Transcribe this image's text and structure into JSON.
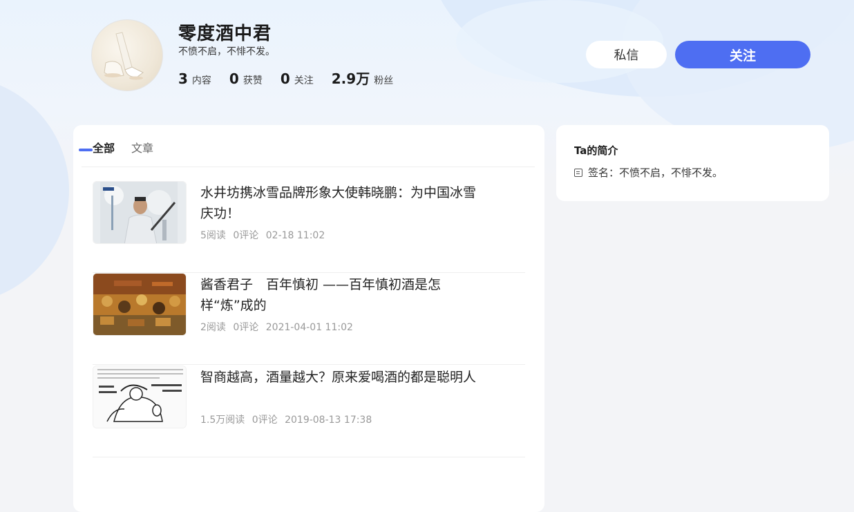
{
  "profile": {
    "name": "零度酒中君",
    "motto": "不愤不启，不悱不发。",
    "stats": [
      {
        "num": "3",
        "label": "内容"
      },
      {
        "num": "0",
        "label": "获赞"
      },
      {
        "num": "0",
        "label": "关注"
      },
      {
        "num": "2.9万",
        "label": "粉丝"
      }
    ],
    "message_label": "私信",
    "follow_label": "关注"
  },
  "tabs": [
    {
      "label": "全部",
      "active": true
    },
    {
      "label": "文章",
      "active": false
    }
  ],
  "articles": [
    {
      "title": "水井坊携冰雪品牌形象大使韩晓鹏：为中国冰雪庆功！",
      "reads": "5阅读",
      "comments": "0评论",
      "date": "02-18 11:02"
    },
    {
      "title": "酱香君子　百年慎初 ——百年慎初酒是怎样“炼”成的",
      "reads": "2阅读",
      "comments": "0评论",
      "date": "2021-04-01 11:02"
    },
    {
      "title": "智商越高，酒量越大？原来爱喝酒的都是聪明人",
      "reads": "1.5万阅读",
      "comments": "0评论",
      "date": "2019-08-13 17:38"
    }
  ],
  "sidebar": {
    "title": "Ta的简介",
    "signature_label": "签名：",
    "signature": "不愤不启，不悱不发。"
  },
  "colors": {
    "accent": "#4e6ef2",
    "background": "#f3f4f7",
    "card": "#ffffff"
  }
}
